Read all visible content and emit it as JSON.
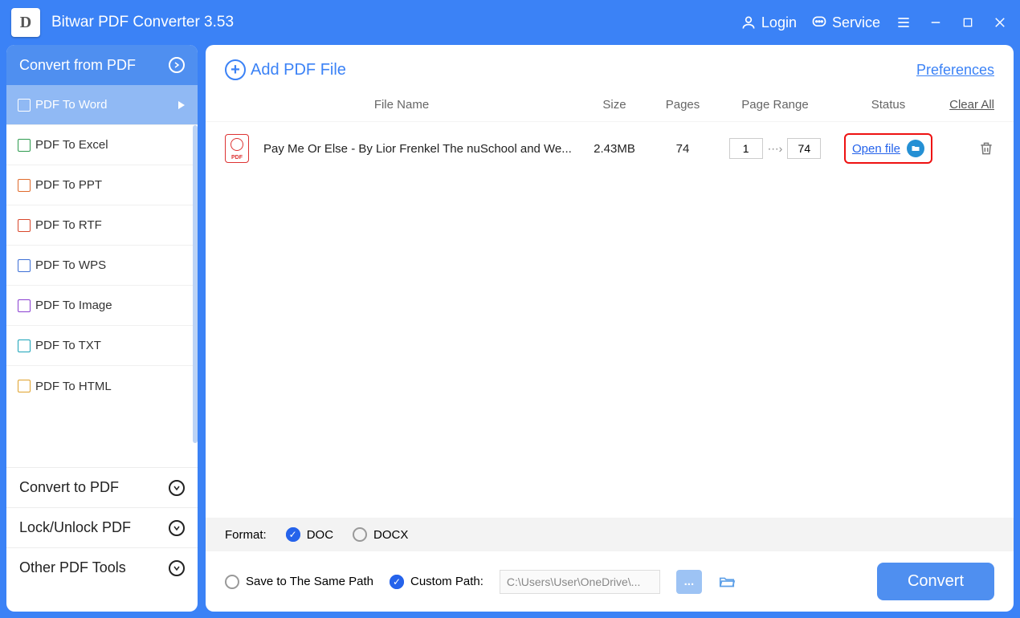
{
  "app": {
    "title": "Bitwar PDF Converter 3.53"
  },
  "titlebar": {
    "login": "Login",
    "service": "Service"
  },
  "sidebar": {
    "section_convert_from": "Convert from PDF",
    "items": [
      {
        "label": "PDF To Word",
        "color": "#fff"
      },
      {
        "label": "PDF To Excel",
        "color": "#2e9b4f"
      },
      {
        "label": "PDF To PPT",
        "color": "#e06a2b"
      },
      {
        "label": "PDF To RTF",
        "color": "#d9472b"
      },
      {
        "label": "PDF To WPS",
        "color": "#3d6fd6"
      },
      {
        "label": "PDF To Image",
        "color": "#8a3fd1"
      },
      {
        "label": "PDF To TXT",
        "color": "#1aa3b8"
      },
      {
        "label": "PDF To HTML",
        "color": "#e0a22b"
      }
    ],
    "section_convert_to": "Convert to PDF",
    "section_lock": "Lock/Unlock PDF",
    "section_other": "Other PDF Tools"
  },
  "main": {
    "add_file": "Add PDF File",
    "preferences": "Preferences",
    "headers": {
      "file_name": "File Name",
      "size": "Size",
      "pages": "Pages",
      "page_range": "Page Range",
      "status": "Status",
      "clear_all": "Clear All"
    },
    "files": [
      {
        "name": "Pay Me Or Else - By Lior Frenkel The nuSchool and We...",
        "size": "2.43MB",
        "pages": "74",
        "range_from": "1",
        "range_to": "74",
        "status_link": "Open file"
      }
    ]
  },
  "format_bar": {
    "label": "Format:",
    "doc": "DOC",
    "docx": "DOCX"
  },
  "path_bar": {
    "same_path": "Save to The Same Path",
    "custom_path": "Custom Path:",
    "path_value": "C:\\Users\\User\\OneDrive\\...",
    "browse": "...",
    "convert": "Convert"
  }
}
